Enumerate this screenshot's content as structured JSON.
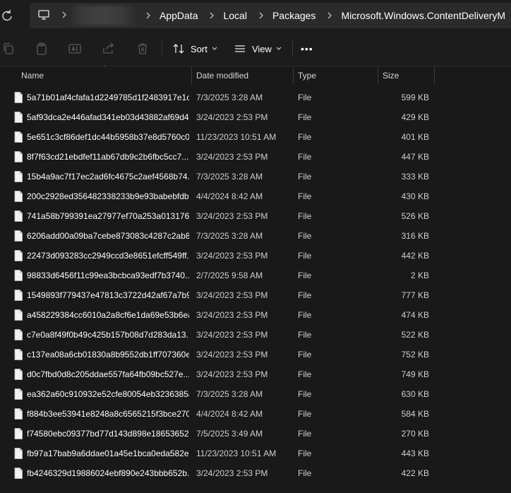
{
  "address_bar": {
    "breadcrumbs": [
      "AppData",
      "Local",
      "Packages",
      "Microsoft.Windows.ContentDeliveryM"
    ]
  },
  "toolbar": {
    "sort_label": "Sort",
    "view_label": "View",
    "more_label": "•••"
  },
  "columns": {
    "name": "Name",
    "date_modified": "Date modified",
    "type": "Type",
    "size": "Size"
  },
  "files": [
    {
      "name": "5a71b01af4cfafa1d2249785d1f2483917e1c...",
      "date": "7/3/2025 3:28 AM",
      "type": "File",
      "size": "599 KB"
    },
    {
      "name": "5af93dca2e446afad341eb03d43882af69d4...",
      "date": "3/24/2023 2:53 PM",
      "type": "File",
      "size": "429 KB"
    },
    {
      "name": "5e651c3cf86def1dc44b5958b37e8d5760c0...",
      "date": "11/23/2023 10:51 AM",
      "type": "File",
      "size": "401 KB"
    },
    {
      "name": "8f7f63cd21ebdfef11ab67db9c2b6fbc5cc7...",
      "date": "3/24/2023 2:53 PM",
      "type": "File",
      "size": "447 KB"
    },
    {
      "name": "15b4a9ac7f17ec2ad6fc4675c2aef4568b74...",
      "date": "7/3/2025 3:28 AM",
      "type": "File",
      "size": "333 KB"
    },
    {
      "name": "200c2928ed356482338233b9e93babebfdb...",
      "date": "4/4/2024 8:42 AM",
      "type": "File",
      "size": "430 KB"
    },
    {
      "name": "741a58b799391ea27977ef70a253a013176e...",
      "date": "3/24/2023 2:53 PM",
      "type": "File",
      "size": "526 KB"
    },
    {
      "name": "6206add00a09ba7cebe873083c4287c2ab8...",
      "date": "7/3/2025 3:28 AM",
      "type": "File",
      "size": "316 KB"
    },
    {
      "name": "22473d093283cc2949ccd3e8651efcff549ff...",
      "date": "3/24/2023 2:53 PM",
      "type": "File",
      "size": "442 KB"
    },
    {
      "name": "98833d6456f11c99ea3bcbca93edf7b3740...",
      "date": "2/7/2025 9:58 AM",
      "type": "File",
      "size": "2 KB"
    },
    {
      "name": "1549893f779437e47813c3722d42af67a7b9...",
      "date": "3/24/2023 2:53 PM",
      "type": "File",
      "size": "777 KB"
    },
    {
      "name": "a458229384cc6010a2a8cf6e1da69e53b6ea...",
      "date": "3/24/2023 2:53 PM",
      "type": "File",
      "size": "474 KB"
    },
    {
      "name": "c7e0a8f49f0b49c425b157b08d7d283da13...",
      "date": "3/24/2023 2:53 PM",
      "type": "File",
      "size": "522 KB"
    },
    {
      "name": "c137ea08a6cb01830a8b9552db1ff707360e...",
      "date": "3/24/2023 2:53 PM",
      "type": "File",
      "size": "752 KB"
    },
    {
      "name": "d0c7fbd0d8c205ddae557fa64fb09bc527e...",
      "date": "3/24/2023 2:53 PM",
      "type": "File",
      "size": "749 KB"
    },
    {
      "name": "ea362a60c910932e52cfe80054eb3236385a...",
      "date": "7/3/2025 3:28 AM",
      "type": "File",
      "size": "630 KB"
    },
    {
      "name": "f884b3ee53941e8248a8c6565215f3bce270...",
      "date": "4/4/2024 8:42 AM",
      "type": "File",
      "size": "584 KB"
    },
    {
      "name": "f74580ebc09377bd77d143d898e18653652...",
      "date": "7/5/2025 3:49 AM",
      "type": "File",
      "size": "270 KB"
    },
    {
      "name": "fb97a17bab9a6ddae01a45e1bca0eda582e...",
      "date": "11/23/2023 10:51 AM",
      "type": "File",
      "size": "443 KB"
    },
    {
      "name": "fb4246329d19886024ebf890e243bbb652b...",
      "date": "3/24/2023 2:53 PM",
      "type": "File",
      "size": "422 KB"
    }
  ],
  "icons": {
    "refresh": "refresh-icon",
    "pc": "this-pc-icon",
    "copy": "copy-icon",
    "paste": "paste-icon",
    "rename": "rename-icon",
    "share": "share-icon",
    "delete": "delete-icon",
    "sort": "sort-icon",
    "view": "view-icon",
    "file": "file-icon"
  },
  "colors": {
    "background": "#191919",
    "address_box": "#2b2b2b",
    "text": "#ffffff",
    "muted_text": "#cfcfcf"
  }
}
